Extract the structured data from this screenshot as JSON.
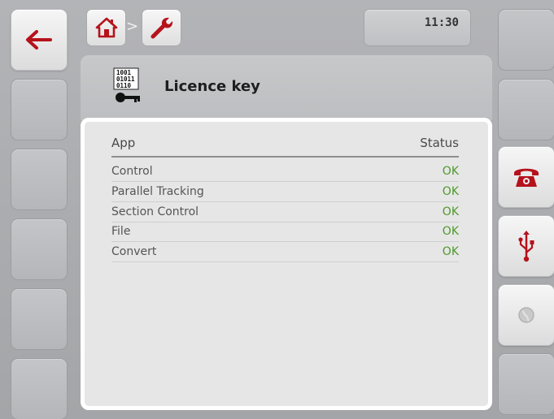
{
  "topbar": {
    "back_icon": "arrow-left-icon",
    "home_icon": "home-icon",
    "separator": ">",
    "wrench_icon": "wrench-icon",
    "time": "11:30"
  },
  "header": {
    "icon": "licence-key-binary-icon",
    "title": "Licence key"
  },
  "table": {
    "col_app": "App",
    "col_status": "Status",
    "rows": [
      {
        "app": "Control",
        "status": "OK"
      },
      {
        "app": "Parallel Tracking",
        "status": "OK"
      },
      {
        "app": "Section Control",
        "status": "OK"
      },
      {
        "app": "File",
        "status": "OK"
      },
      {
        "app": "Convert",
        "status": "OK"
      }
    ]
  },
  "right_softkeys": [
    "phone-icon",
    "usb-icon",
    "globe-icon"
  ],
  "colors": {
    "accent": "#b5121b",
    "status_ok": "#4d9a2a",
    "background": "#a9aaad"
  }
}
